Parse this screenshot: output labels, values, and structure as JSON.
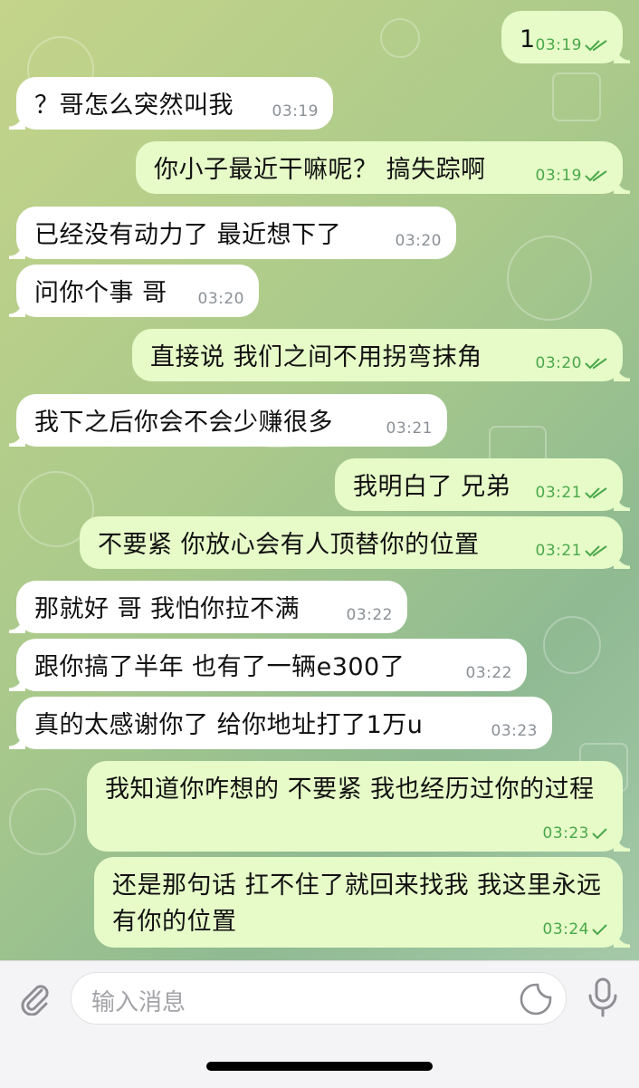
{
  "messages": [
    {
      "text": "1",
      "time": "03:19",
      "status": "read"
    },
    {
      "text": "？哥怎么突然叫我",
      "time": "03:19"
    },
    {
      "text": "你小子最近干嘛呢？ 搞失踪啊",
      "time": "03:19",
      "status": "read"
    },
    {
      "text": "已经没有动力了 最近想下了",
      "time": "03:20"
    },
    {
      "text": "问你个事 哥",
      "time": "03:20"
    },
    {
      "text": "直接说 我们之间不用拐弯抹角",
      "time": "03:20",
      "status": "read"
    },
    {
      "text": "我下之后你会不会少赚很多",
      "time": "03:21"
    },
    {
      "text": "我明白了 兄弟",
      "time": "03:21",
      "status": "read"
    },
    {
      "text": "不要紧 你放心会有人顶替你的位置",
      "time": "03:21",
      "status": "read"
    },
    {
      "text": "那就好 哥 我怕你拉不满",
      "time": "03:22"
    },
    {
      "text": "跟你搞了半年 也有了一辆e300了",
      "time": "03:22"
    },
    {
      "text": "真的太感谢你了 给你地址打了1万u",
      "time": "03:23"
    },
    {
      "text": "我知道你咋想的  不要紧 我也经历过你的过程",
      "time": "03:23",
      "status": "sent"
    },
    {
      "text": "还是那句话 扛不住了就回来找我 我这里永远有你的位置",
      "time": "03:24",
      "status": "sent"
    }
  ],
  "composer": {
    "placeholder": "输入消息"
  },
  "icons": {
    "attach": "paperclip-icon",
    "sticker": "sticker-icon",
    "mic": "microphone-icon",
    "read": "double-check-icon",
    "sent": "single-check-icon"
  },
  "colors": {
    "outgoing_bubble": "#e6fbc8",
    "incoming_bubble": "#ffffff",
    "check": "#4aa84a",
    "time_incoming": "#8a9096"
  }
}
